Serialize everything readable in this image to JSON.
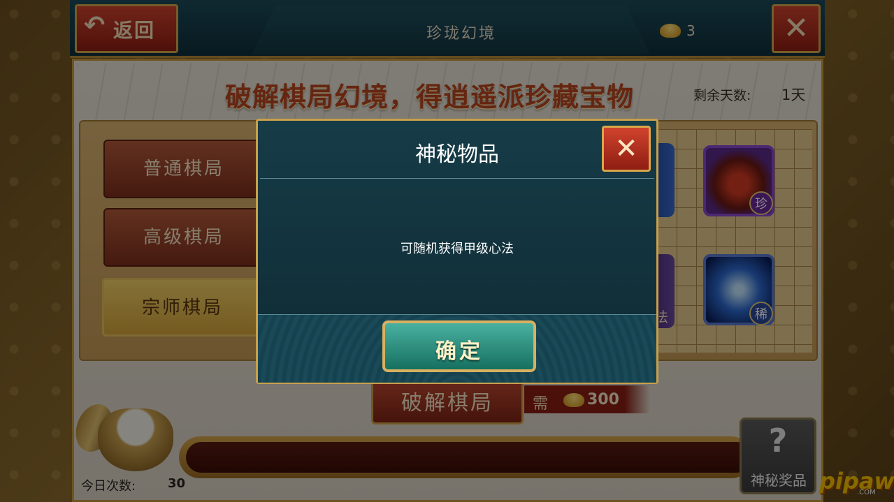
{
  "header": {
    "back_label": "返回",
    "title": "珍珑幻境",
    "gold_count": "3"
  },
  "headline": "破解棋局幻境，得逍遥派珍藏宝物",
  "days_remaining": {
    "label": "剩余天数:",
    "value": "1天"
  },
  "tabs": [
    {
      "label": "普通棋局",
      "selected": false
    },
    {
      "label": "高级棋局",
      "selected": false
    },
    {
      "label": "宗师棋局",
      "selected": true
    }
  ],
  "items": [
    {
      "badge": "珍"
    },
    {
      "badge": "稀"
    }
  ],
  "partial_item_text": "法",
  "crack": {
    "label": "破解棋局",
    "need_label": "需",
    "cost": "300"
  },
  "today": {
    "label": "今日次数:",
    "value": "30"
  },
  "prize": {
    "symbol": "?",
    "label": "神秘奖品"
  },
  "dialog": {
    "title": "神秘物品",
    "body": "可随机获得甲级心法",
    "confirm_label": "确定"
  },
  "watermark": {
    "text": "pipaw",
    "suffix": ".COM"
  }
}
